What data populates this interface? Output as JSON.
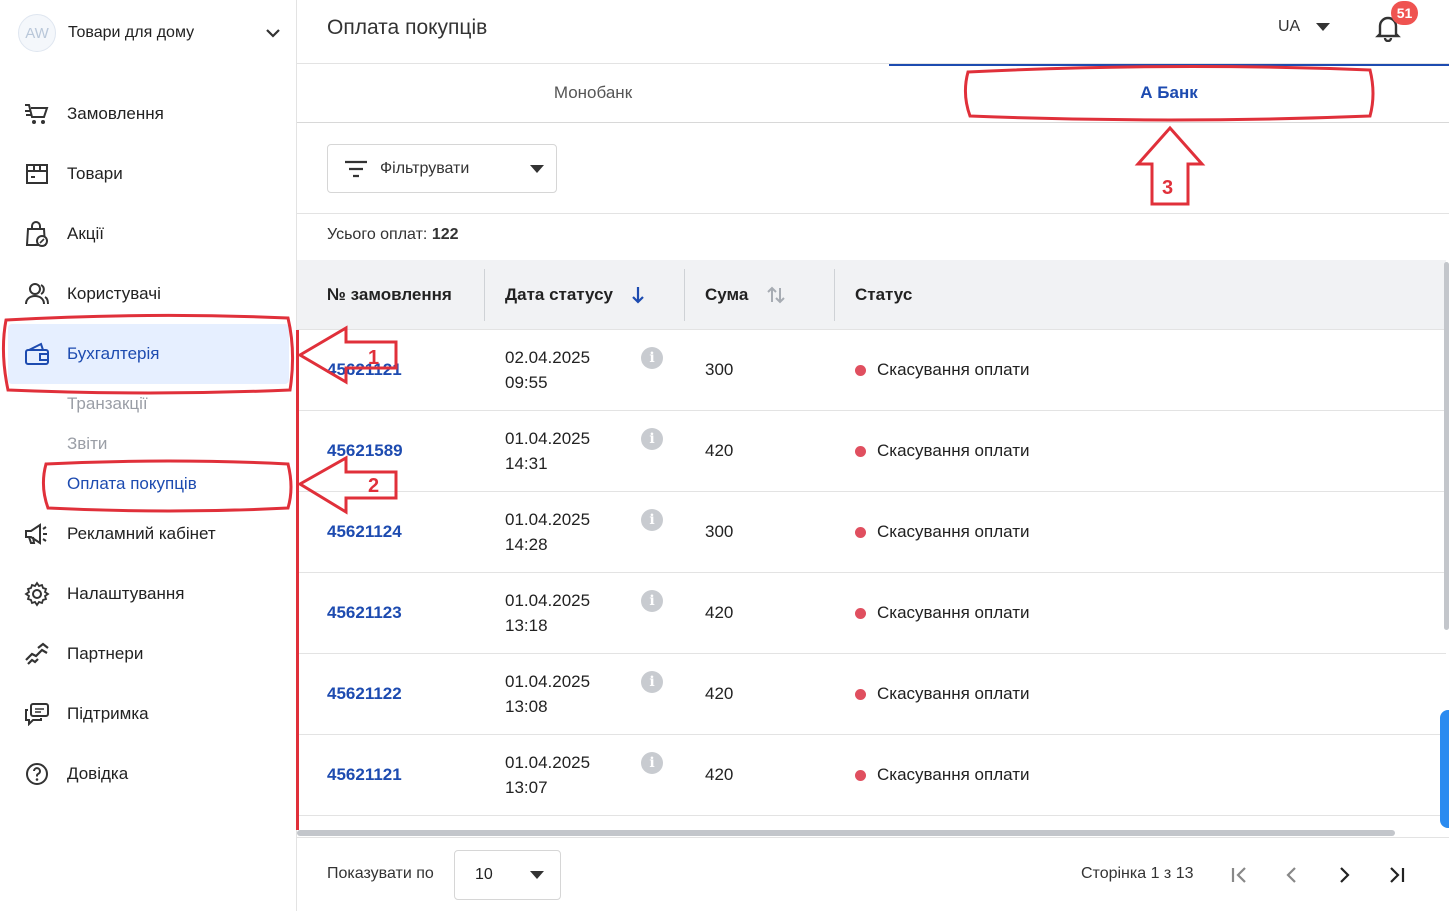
{
  "sidebar": {
    "avatar_initials": "AW",
    "store_name": "Товари для дому",
    "items": [
      {
        "label": "Замовлення",
        "icon": "cart-icon"
      },
      {
        "label": "Товари",
        "icon": "box-icon"
      },
      {
        "label": "Акції",
        "icon": "promo-bag-icon"
      },
      {
        "label": "Користувачі",
        "icon": "users-icon"
      },
      {
        "label": "Бухгалтерія",
        "icon": "wallet-icon",
        "active": true
      },
      {
        "label": "Рекламний кабінет",
        "icon": "megaphone-icon"
      },
      {
        "label": "Налаштування",
        "icon": "gear-icon"
      },
      {
        "label": "Партнери",
        "icon": "handshake-icon"
      },
      {
        "label": "Підтримка",
        "icon": "chat-icon"
      },
      {
        "label": "Довідка",
        "icon": "help-icon"
      }
    ],
    "subitems": [
      {
        "label": "Транзакції"
      },
      {
        "label": "Звіти"
      },
      {
        "label": "Оплата покупців",
        "current": true
      }
    ]
  },
  "header": {
    "title": "Оплата покупців",
    "language": "UA",
    "notifications_count": "51"
  },
  "tabs": [
    {
      "label": "Монобанк"
    },
    {
      "label": "А Банк",
      "active": true
    }
  ],
  "filter": {
    "label": "Фільтрувати"
  },
  "total": {
    "label": "Усього оплат:",
    "value": "122"
  },
  "table": {
    "columns": [
      "№ замовлення",
      "Дата статусу",
      "Сума",
      "Статус"
    ],
    "rows": [
      {
        "order": "45621121",
        "date": "02.04.2025",
        "time": "09:55",
        "sum": "300",
        "status": "Скасування оплати"
      },
      {
        "order": "45621589",
        "date": "01.04.2025",
        "time": "14:31",
        "sum": "420",
        "status": "Скасування оплати"
      },
      {
        "order": "45621124",
        "date": "01.04.2025",
        "time": "14:28",
        "sum": "300",
        "status": "Скасування оплати"
      },
      {
        "order": "45621123",
        "date": "01.04.2025",
        "time": "13:18",
        "sum": "420",
        "status": "Скасування оплати"
      },
      {
        "order": "45621122",
        "date": "01.04.2025",
        "time": "13:08",
        "sum": "420",
        "status": "Скасування оплати"
      },
      {
        "order": "45621121",
        "date": "01.04.2025",
        "time": "13:07",
        "sum": "420",
        "status": "Скасування оплати"
      }
    ]
  },
  "pagination": {
    "page_size_label": "Показувати по",
    "page_size": "10",
    "page_info": "Сторінка 1 з 13"
  },
  "annotations": {
    "marker_1": "1",
    "marker_2": "2",
    "marker_3": "3",
    "color": "#e0303a"
  },
  "colors": {
    "accent": "#1d4bb0",
    "active_bg": "#e6efff",
    "status_dot": "#e04f5f",
    "badge": "#ef5350"
  }
}
